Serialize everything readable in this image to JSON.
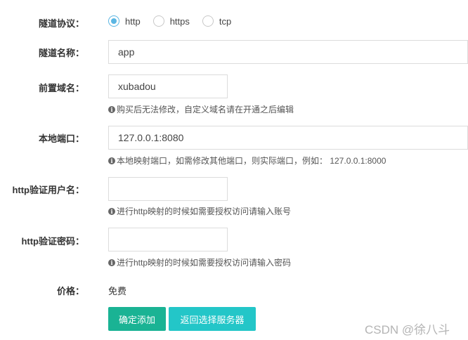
{
  "form": {
    "protocol": {
      "label": "隧道协议：",
      "options": [
        {
          "label": "http",
          "checked": true
        },
        {
          "label": "https",
          "checked": false
        },
        {
          "label": "tcp",
          "checked": false
        }
      ]
    },
    "tunnel_name": {
      "label": "隧道名称：",
      "value": "app"
    },
    "subdomain": {
      "label": "前置域名：",
      "value": "xubadou",
      "hint": "购买后无法修改，自定义域名请在开通之后编辑"
    },
    "local_port": {
      "label": "本地端口：",
      "value": "127.0.0.1:8080",
      "hint": "本地映射端口，如需修改其他端口，则实际端口，例如： 127.0.0.1:8000"
    },
    "http_user": {
      "label": "http验证用户名：",
      "value": "",
      "hint": "进行http映射的时候如需要授权访问请输入账号"
    },
    "http_password": {
      "label": "http验证密码：",
      "value": "",
      "hint": "进行http映射的时候如需要授权访问请输入密码"
    },
    "price": {
      "label": "价格：",
      "value": "免费"
    },
    "buttons": {
      "confirm": "确定添加",
      "back": "返回选择服务器"
    }
  },
  "icons": {
    "info": "info-circle-icon"
  },
  "colors": {
    "radio_accent": "#5bb6e3",
    "primary": "#1ab394",
    "info": "#23c6c8"
  },
  "watermark": "CSDN @徐八斗"
}
